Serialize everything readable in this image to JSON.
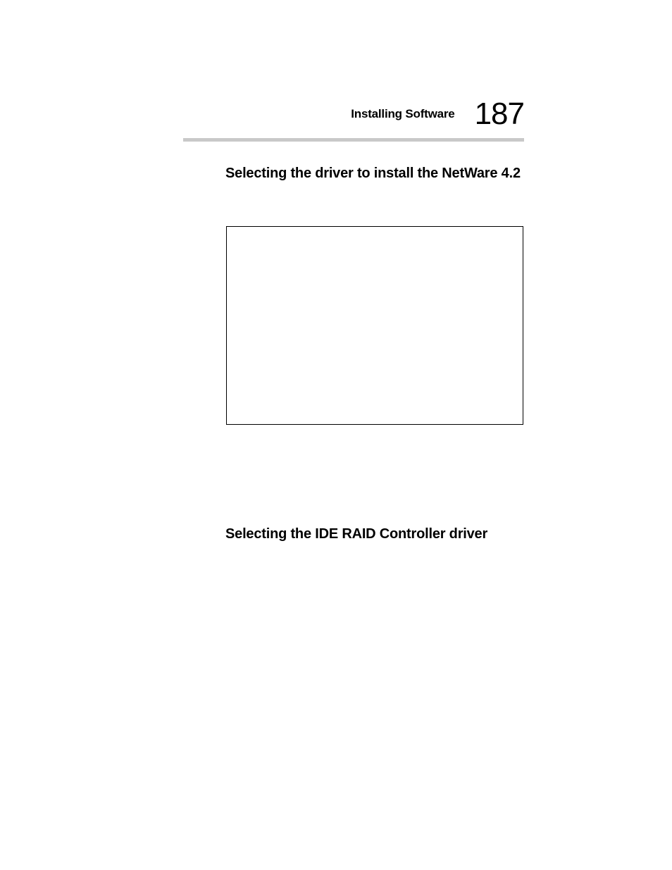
{
  "header": {
    "running_title": "Installing Software",
    "page_number": "187"
  },
  "sections": {
    "s1": "Selecting the driver to install the NetWare 4.2",
    "s2": "Selecting the IDE RAID Controller driver"
  }
}
